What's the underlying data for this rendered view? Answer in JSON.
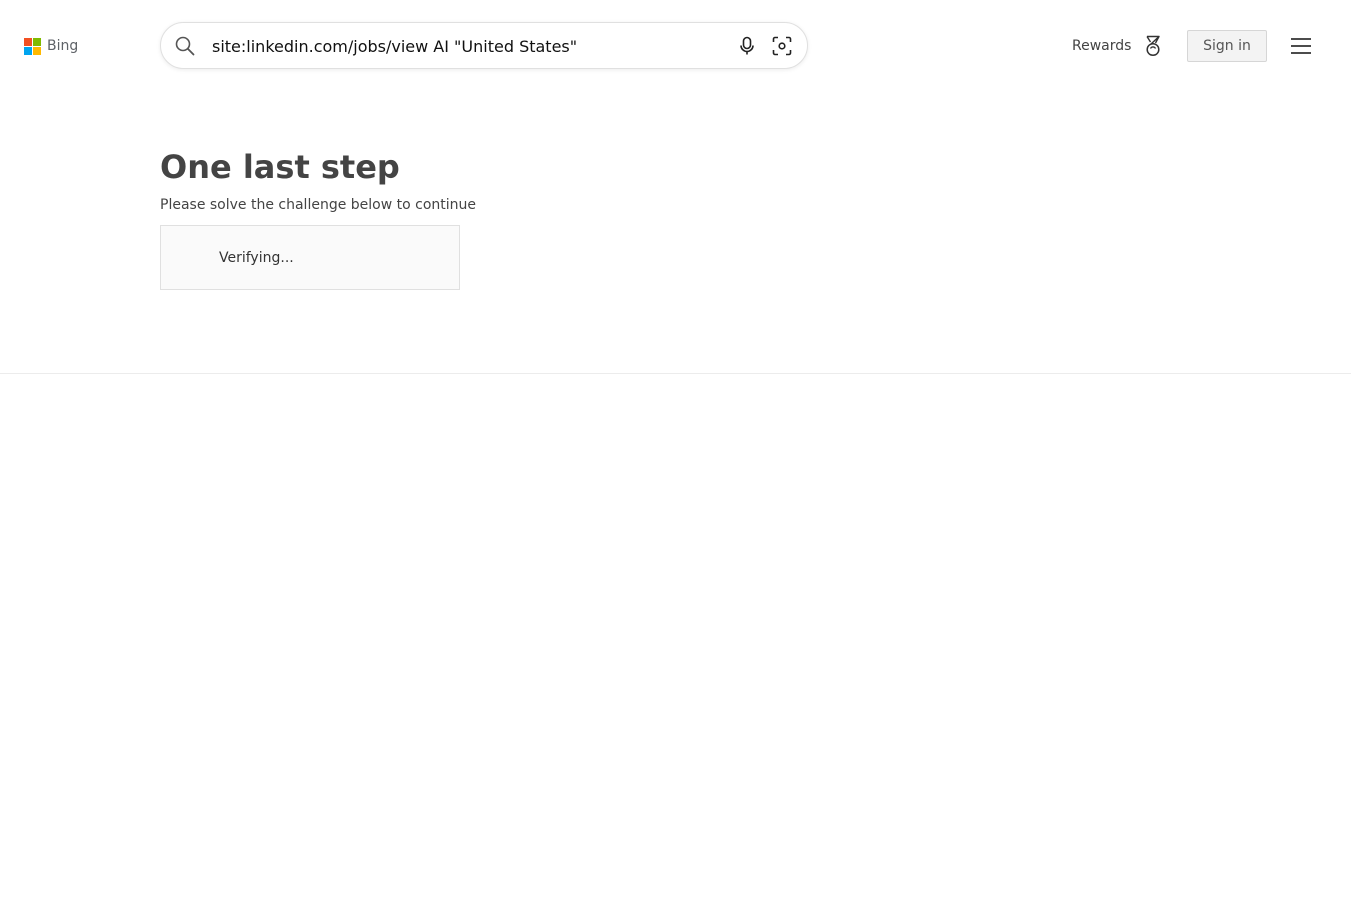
{
  "header": {
    "brand_name": "Bing",
    "logo_colors": [
      "#f25022",
      "#7fba00",
      "#00a4ef",
      "#ffb900"
    ],
    "search": {
      "value": "site:linkedin.com/jobs/view AI \"United States\"",
      "icons": [
        "search-icon",
        "microphone-icon",
        "visual-search-icon"
      ]
    },
    "rewards_label": "Rewards",
    "rewards_icon": "rewards-medal-icon",
    "signin_label": "Sign in",
    "menu_icon": "hamburger-menu-icon"
  },
  "main": {
    "title": "One last step",
    "subtitle": "Please solve the challenge below to continue",
    "challenge_status": "Verifying..."
  }
}
